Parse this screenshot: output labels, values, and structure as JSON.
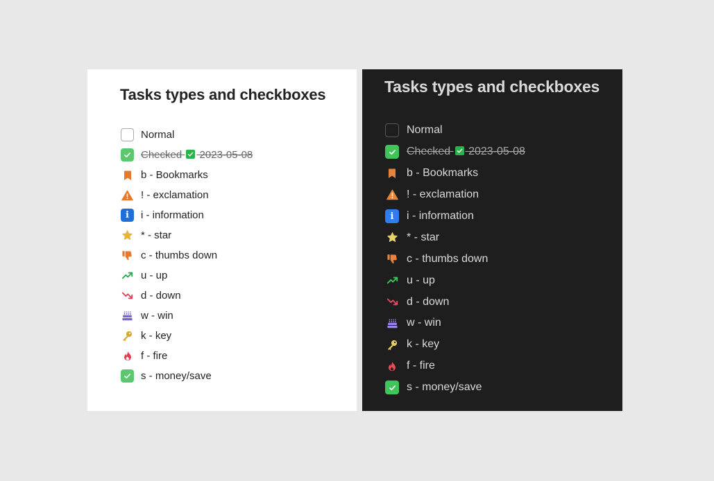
{
  "title": "Tasks types and checkboxes",
  "items": [
    {
      "icon": "empty-checkbox-icon",
      "label": "Normal"
    },
    {
      "icon": "checked-checkbox-icon",
      "label": "Checked",
      "done_icon": "white-check-mark-icon",
      "date": "2023-05-08"
    },
    {
      "icon": "bookmark-icon",
      "label": "b - Bookmarks"
    },
    {
      "icon": "warning-icon",
      "label": "! - exclamation"
    },
    {
      "icon": "info-icon",
      "label": "i - information"
    },
    {
      "icon": "star-icon",
      "label": "* - star"
    },
    {
      "icon": "thumbs-down-icon",
      "label": "c - thumbs down"
    },
    {
      "icon": "trend-up-icon",
      "label": "u - up"
    },
    {
      "icon": "trend-down-icon",
      "label": "d - down"
    },
    {
      "icon": "cake-icon",
      "label": "w - win"
    },
    {
      "icon": "key-icon",
      "label": "k - key"
    },
    {
      "icon": "fire-icon",
      "label": "f - fire"
    },
    {
      "icon": "checked-checkbox-icon",
      "label": "s - money/save"
    }
  ],
  "info_glyph": "i",
  "colors": {
    "background": "#e8e8e8",
    "light_panel": "#ffffff",
    "dark_panel": "#1e1e1e",
    "check_green": "#5bc86e",
    "orange": "#e8792c",
    "info_blue": "#1e70d6",
    "star_yellow": "#e7b43a",
    "up_green": "#2ea84f",
    "down_red": "#e0405a",
    "win_purple": "#7b61d9",
    "fire_red": "#e83a4f"
  }
}
